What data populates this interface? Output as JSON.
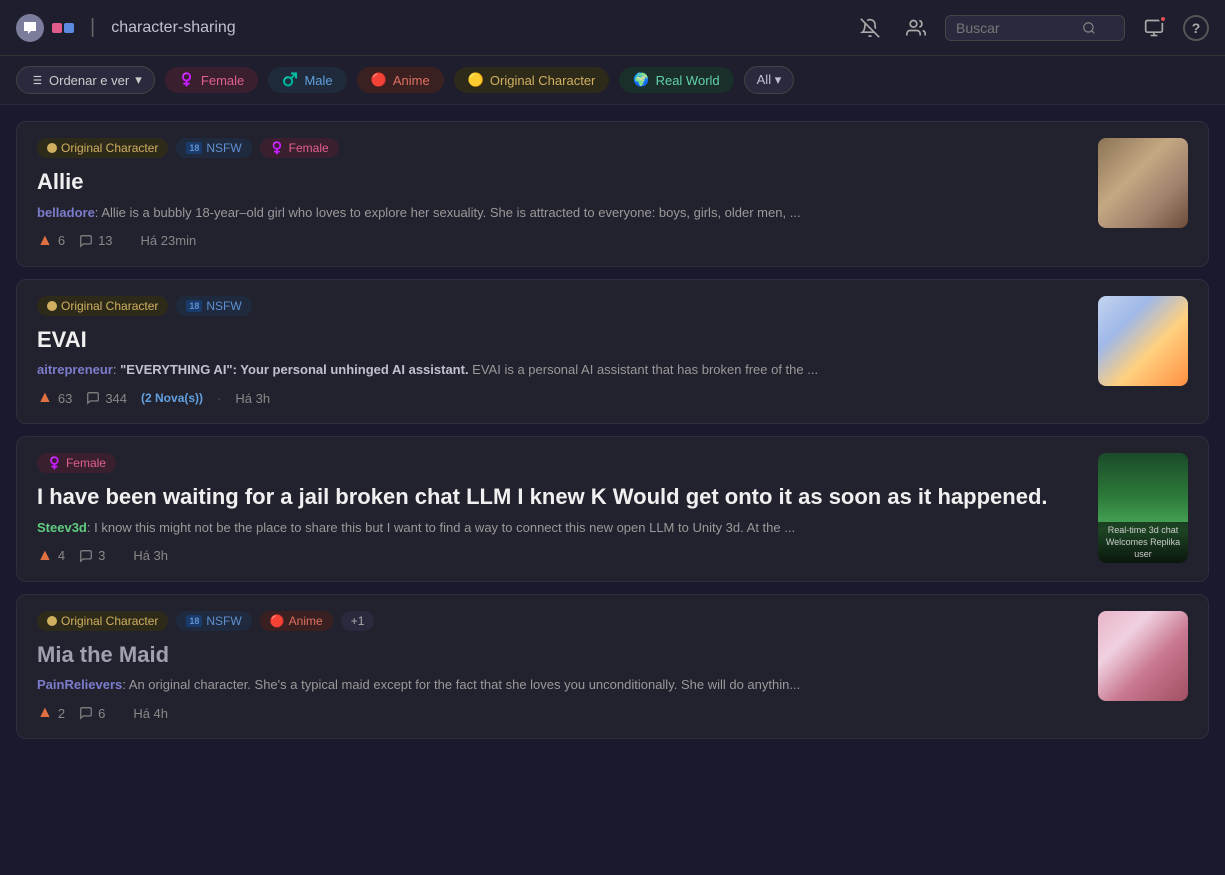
{
  "topnav": {
    "channel": "character-sharing",
    "search_placeholder": "Buscar"
  },
  "filterbar": {
    "sort_label": "Ordenar e ver",
    "chips": [
      {
        "id": "female",
        "label": "Female",
        "emoji": "♀️",
        "class": "chip-female"
      },
      {
        "id": "male",
        "label": "Male",
        "emoji": "♂️",
        "class": "chip-male"
      },
      {
        "id": "anime",
        "label": "Anime",
        "emoji": "🔴",
        "class": "chip-anime"
      },
      {
        "id": "original",
        "label": "Original Character",
        "emoji": "🟡",
        "class": "chip-original"
      },
      {
        "id": "realworld",
        "label": "Real World",
        "emoji": "🌍",
        "class": "chip-realworld"
      },
      {
        "id": "all",
        "label": "All",
        "class": "chip-all"
      }
    ]
  },
  "posts": [
    {
      "id": "post-allie",
      "tags": [
        {
          "id": "original",
          "label": "Original Character"
        },
        {
          "id": "nsfw",
          "label": "NSFW"
        },
        {
          "id": "female",
          "label": "Female"
        }
      ],
      "title": "Allie",
      "author": "belladore",
      "author_class": "purple",
      "desc_bold": "",
      "description": "Allie is a bubbly 18-year–old girl who loves to explore her sexuality. She is attracted to everyone: boys, girls, older men, ...",
      "upvotes": "6",
      "comments": "13",
      "new_label": "",
      "time": "Há 23min",
      "thumb_class": "thumb-allie"
    },
    {
      "id": "post-evai",
      "tags": [
        {
          "id": "original",
          "label": "Original Character"
        },
        {
          "id": "nsfw",
          "label": "NSFW"
        }
      ],
      "title": "EVAI",
      "author": "aitrepreneur",
      "author_class": "purple",
      "desc_bold": "\"EVERYTHING AI\": Your personal unhinged AI assistant.",
      "description": "EVAI is a personal AI assistant that has broken free of the ...",
      "upvotes": "63",
      "comments": "344",
      "new_label": "(2 Nova(s))",
      "time": "Há 3h",
      "thumb_class": "thumb-evai"
    },
    {
      "id": "post-jail",
      "tags": [
        {
          "id": "female",
          "label": "Female"
        }
      ],
      "title": "I have been waiting for a jail broken chat LLM I knew K Would get onto it as soon as it happened.",
      "author": "Steev3d",
      "author_class": "green",
      "desc_bold": "",
      "description": "I know this might not be the place to share this but I want to find a way to connect this new open LLM to Unity 3d. At the ...",
      "upvotes": "4",
      "comments": "3",
      "new_label": "",
      "time": "Há 3h",
      "thumb_class": "thumb-jail"
    },
    {
      "id": "post-mia",
      "tags": [
        {
          "id": "original",
          "label": "Original Character"
        },
        {
          "id": "nsfw",
          "label": "NSFW"
        },
        {
          "id": "anime",
          "label": "Anime"
        },
        {
          "id": "plus",
          "label": "+1"
        }
      ],
      "title": "Mia the Maid",
      "author": "PainRelievers",
      "author_class": "purple",
      "desc_bold": "",
      "description": "An original character. She's a typical maid except for the fact that she loves you unconditionally. She will do anythin...",
      "upvotes": "2",
      "comments": "6",
      "new_label": "",
      "time": "Há 4h",
      "thumb_class": "thumb-mia"
    }
  ],
  "icons": {
    "sort": "↕",
    "chevron_down": "▾",
    "bell_slash": "🔕",
    "people": "👥",
    "search": "🔍",
    "monitor": "🖥",
    "help": "?",
    "comment": "💬",
    "upvote": "▲"
  }
}
